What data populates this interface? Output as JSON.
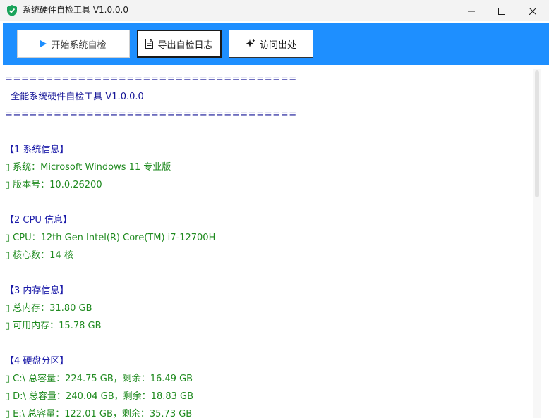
{
  "window": {
    "title": "系统硬件自检工具 V1.0.0.0",
    "icon": "shield-icon",
    "controls": [
      "minimize-icon",
      "maximize-icon",
      "close-icon"
    ]
  },
  "toolbar": {
    "start_label": "开始系统自检",
    "start_icon": "play-icon",
    "export_label": "导出自检日志",
    "export_icon": "document-icon",
    "visit_label": "访问出处",
    "visit_icon": "sparkle-icon",
    "background": "#1e8fff"
  },
  "log": {
    "separator": "====================================",
    "header_title": "  全能系统硬件自检工具 V1.0.0.0",
    "sections": [
      {
        "heading": "【1 系统信息】",
        "items": [
          "系统：Microsoft Windows 11 专业版",
          "版本号：10.0.26200"
        ]
      },
      {
        "heading": "【2 CPU 信息】",
        "items": [
          "CPU：12th Gen Intel(R) Core(TM) i7-12700H",
          "核心数：14 核"
        ]
      },
      {
        "heading": "【3 内存信息】",
        "items": [
          "总内存：31.80 GB",
          "可用内存：15.78 GB"
        ]
      },
      {
        "heading": "【4 硬盘分区】",
        "items": [
          "C:\\ 总容量：224.75 GB，剩余：16.49 GB",
          "D:\\ 总容量：240.04 GB，剩余：18.83 GB",
          "E:\\ 总容量：122.01 GB，剩余：35.73 GB"
        ]
      }
    ],
    "bullet": "▯",
    "colors": {
      "heading": "#1a1aa8",
      "item": "#1f8a1f",
      "header": "#141496"
    }
  }
}
